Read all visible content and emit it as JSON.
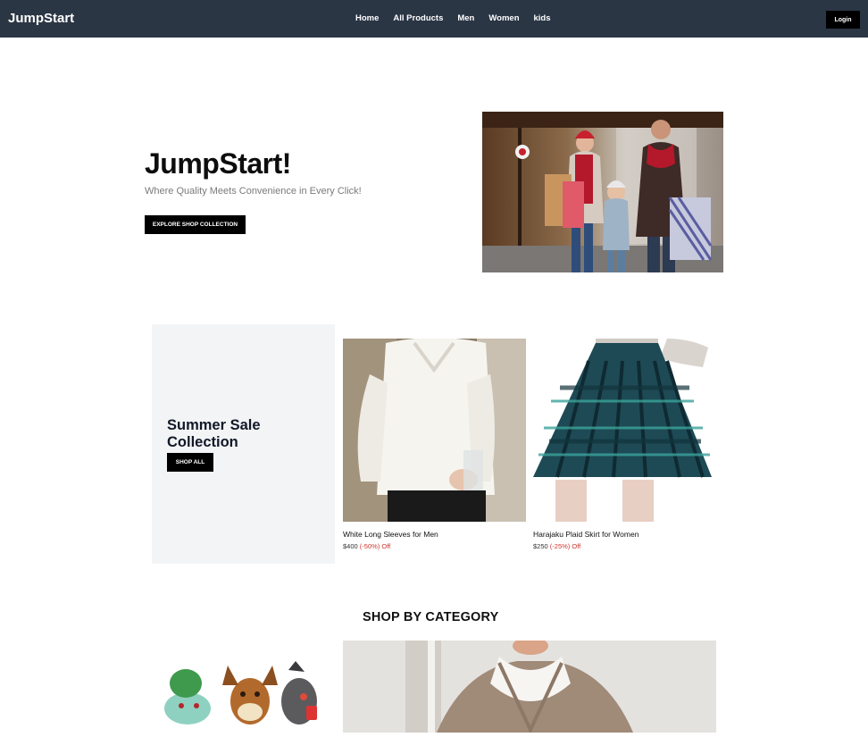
{
  "navbar": {
    "brand": "JumpStart",
    "links": [
      "Home",
      "All Products",
      "Men",
      "Women",
      "kids"
    ],
    "login_label": "Login"
  },
  "hero": {
    "title": "JumpStart!",
    "subtitle": "Where Quality Meets Convenience in Every Click!",
    "cta_label": "EXPLORE SHOP COLLECTION"
  },
  "sale": {
    "title": "Summer Sale Collection",
    "cta_label": "SHOP ALL",
    "products": [
      {
        "name": "White Long Sleeves for Men",
        "price": "$400",
        "discount": "(-50%) Off"
      },
      {
        "name": "Harajaku Plaid Skirt for Women",
        "price": "$250",
        "discount": "(-25%) Off"
      }
    ]
  },
  "categories": {
    "heading": "SHOP BY CATEGORY"
  },
  "colors": {
    "navbar_bg": "#2b3645",
    "sale_panel_bg": "#f3f4f6",
    "discount": "#d0352b"
  }
}
